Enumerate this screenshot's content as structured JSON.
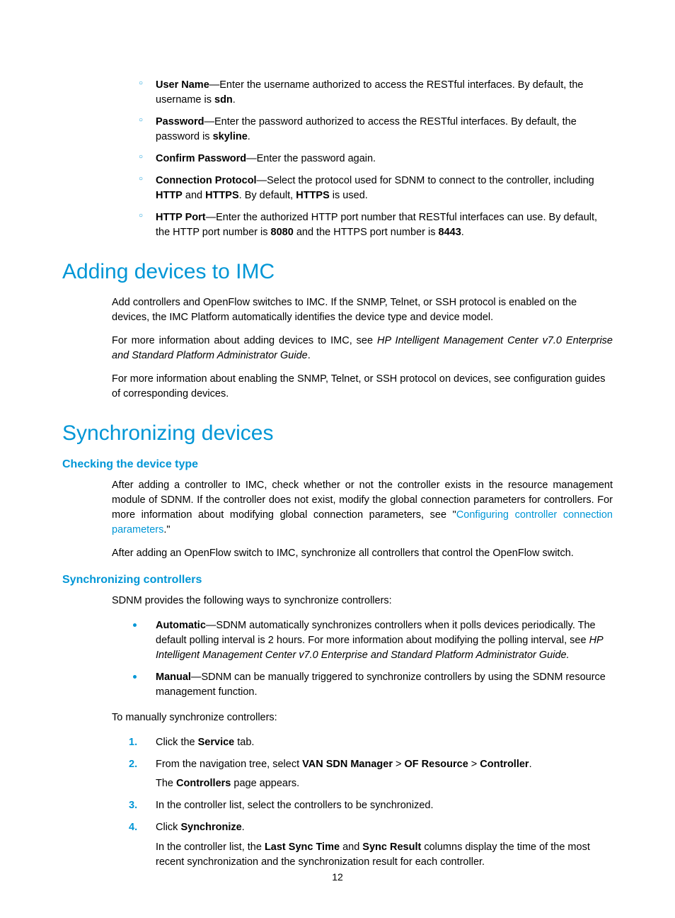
{
  "config_items": [
    {
      "label": "User Name",
      "text_a": "—Enter the username authorized to access the RESTful interfaces. By default, the username is ",
      "bold_a": "sdn",
      "text_b": "."
    },
    {
      "label": "Password",
      "text_a": "—Enter the password authorized to access the RESTful interfaces. By default, the password is ",
      "bold_a": "skyline",
      "text_b": "."
    },
    {
      "label": "Confirm Password",
      "text_a": "—Enter the password again."
    },
    {
      "label": "Connection Protocol",
      "text_a": "—Select the protocol used for SDNM to connect to the controller, including ",
      "bold_a": "HTTP",
      "text_b": " and ",
      "bold_b": "HTTPS",
      "text_c": ". By default, ",
      "bold_c": "HTTPS",
      "text_d": " is used."
    },
    {
      "label": "HTTP Port",
      "text_a": "—Enter the authorized HTTP port number that RESTful interfaces can use. By default, the HTTP port number is ",
      "bold_a": "8080",
      "text_b": " and the HTTPS port number is ",
      "bold_b": "8443",
      "text_c": "."
    }
  ],
  "h_add": "Adding devices to IMC",
  "add_p1": "Add controllers and OpenFlow switches to IMC. If the SNMP, Telnet, or SSH protocol is enabled on the devices, the IMC Platform automatically identifies the device type and device model.",
  "add_p2a": "For more information about adding devices to IMC, see ",
  "add_p2i": "HP Intelligent Management Center v7.0 Enterprise and Standard Platform Administrator Guide",
  "add_p2b": ".",
  "add_p3": "For more information about enabling the SNMP, Telnet, or SSH protocol on devices, see configuration guides of corresponding devices.",
  "h_sync": "Synchronizing devices",
  "h_check": "Checking the device type",
  "check_p1a": "After adding a controller to IMC, check whether or not the controller exists in the resource management module of SDNM. If the controller does not exist, modify the global connection parameters for controllers. For more information about modifying global connection parameters, see \"",
  "check_link": "Configuring controller connection parameters",
  "check_p1b": ".\"",
  "check_p2": "After adding an OpenFlow switch to IMC, synchronize all controllers that control the OpenFlow switch.",
  "h_syncctl": "Synchronizing controllers",
  "syncctl_intro": "SDNM provides the following ways to synchronize controllers:",
  "ways": [
    {
      "label": "Automatic",
      "text_a": "—SDNM automatically synchronizes controllers when it polls devices periodically. The default polling interval is 2 hours. For more information about modifying the polling interval, see ",
      "italic": "HP Intelligent Management Center v7.0 Enterprise and Standard Platform Administrator Guide.",
      "text_b": ""
    },
    {
      "label": "Manual",
      "text_a": "—SDNM can be manually triggered to synchronize controllers by using the SDNM resource management function."
    }
  ],
  "manual_intro": "To manually synchronize controllers:",
  "steps": {
    "s1a": "Click the ",
    "s1b": "Service",
    "s1c": " tab.",
    "s2a": "From the navigation tree, select ",
    "s2b": "VAN SDN Manager",
    "s2c": " > ",
    "s2d": "OF Resource",
    "s2e": " > ",
    "s2f": "Controller",
    "s2g": ".",
    "s2extra_a": "The ",
    "s2extra_b": "Controllers",
    "s2extra_c": " page appears.",
    "s3": "In the controller list, select the controllers to be synchronized.",
    "s4a": "Click ",
    "s4b": "Synchronize",
    "s4c": ".",
    "s4extra_a": "In the controller list, the ",
    "s4extra_b": "Last Sync Time",
    "s4extra_c": " and ",
    "s4extra_d": "Sync Result",
    "s4extra_e": " columns display the time of the most recent synchronization and the synchronization result for each controller."
  },
  "page_number": "12"
}
